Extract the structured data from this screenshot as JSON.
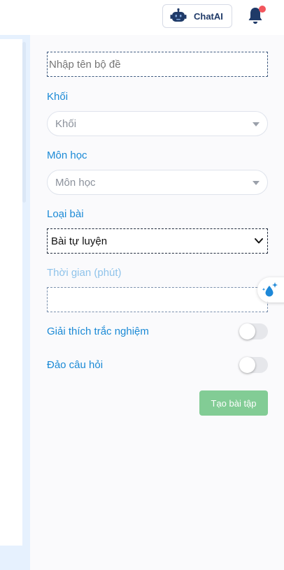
{
  "header": {
    "chat_label": "ChatAI",
    "chat_icon": "robot-icon",
    "bell_icon": "bell-icon",
    "bell_dot_color": "#f2565d"
  },
  "form": {
    "name_placeholder": "Nhập tên bộ đề",
    "grade_label": "Khối",
    "grade_placeholder": "Khối",
    "subject_label": "Môn học",
    "subject_placeholder": "Môn học",
    "type_label": "Loại bài",
    "type_value": "Bài tự luyện",
    "time_label": "Thời gian (phút)",
    "time_value": "",
    "explain_label": "Giải thích trắc nghiệm",
    "explain_on": false,
    "shuffle_label": "Đảo câu hỏi",
    "shuffle_on": false,
    "submit_label": "Tạo bài tập"
  },
  "colors": {
    "label": "#1b8ad6",
    "submit_bg": "#82cc95",
    "panel_bg": "#fafafc",
    "left_bg": "#e6f1fe"
  },
  "floating": {
    "icon": "sparkle-drop-icon"
  }
}
